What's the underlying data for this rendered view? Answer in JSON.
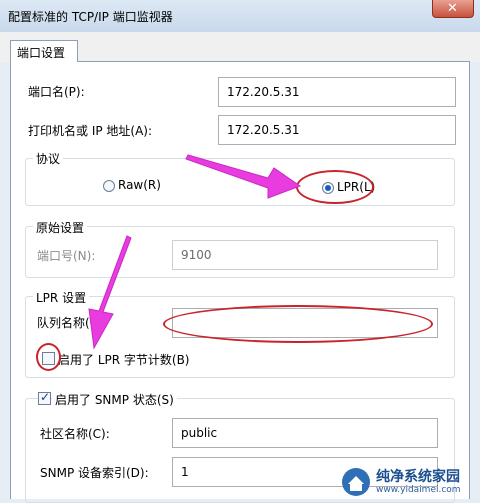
{
  "window": {
    "title": "配置标准的 TCP/IP 端口监视器",
    "close_glyph": "✕"
  },
  "tabs": [
    {
      "label": "端口设置",
      "selected": true
    }
  ],
  "port_name": {
    "label": "端口名(P):",
    "value": "172.20.5.31"
  },
  "printer_address": {
    "label": "打印机名或 IP 地址(A):",
    "value": "172.20.5.31"
  },
  "protocol": {
    "title": "协议",
    "options": [
      {
        "label": "Raw(R)",
        "selected": false
      },
      {
        "label": "LPR(L)",
        "selected": true
      }
    ]
  },
  "raw_settings": {
    "title": "原始设置",
    "port_number_label": "端口号(N):",
    "port_number_value": "9100"
  },
  "lpr_settings": {
    "title": "LPR 设置",
    "queue_name_label": "队列名称(Q):",
    "queue_name_value": "",
    "byte_count": {
      "label": "启用了 LPR 字节计数(B)",
      "checked": false
    }
  },
  "snmp": {
    "enabled": {
      "label": "启用了 SNMP 状态(S)",
      "checked": true
    },
    "community_label": "社区名称(C):",
    "community_value": "public",
    "device_index_label": "SNMP 设备索引(D):",
    "device_index_value": "1"
  },
  "annotations": {
    "arrow_color": "#e83ce0",
    "circle_color": "#c8242a"
  },
  "watermark": {
    "title": "纯净系统家园",
    "url": "www.yidaimei.com"
  }
}
